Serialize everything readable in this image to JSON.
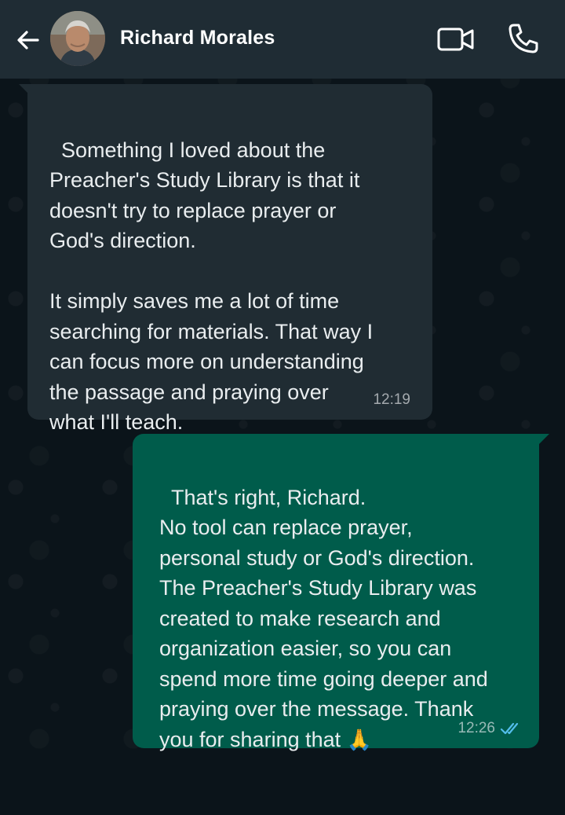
{
  "header": {
    "contact_name": "Richard Morales",
    "icons": [
      "back-arrow-icon",
      "video-call-icon",
      "voice-call-icon"
    ]
  },
  "messages": [
    {
      "direction": "incoming",
      "text": "Something I loved about the\nPreacher's Study Library is that it\ndoesn't try to replace prayer or\nGod's direction.\n\nIt simply saves me a lot of time\nsearching for materials. That way I\ncan focus more on understanding\nthe passage and praying over\nwhat I'll teach.",
      "time": "12:19"
    },
    {
      "direction": "outgoing",
      "text": "That's right, Richard.\nNo tool can replace prayer,\npersonal study or God's direction.\nThe Preacher's Study Library was\ncreated to make research and\norganization easier, so you can\nspend more time going deeper and\npraying over the message. Thank\nyou for sharing that ",
      "emoji": "🙏",
      "time": "12:26",
      "status": "read"
    }
  ],
  "colors": {
    "header_bg": "#1f2c34",
    "chat_bg": "#0b141a",
    "incoming_bubble": "#202c33",
    "outgoing_bubble": "#005c4b",
    "read_ticks": "#53bdeb"
  }
}
